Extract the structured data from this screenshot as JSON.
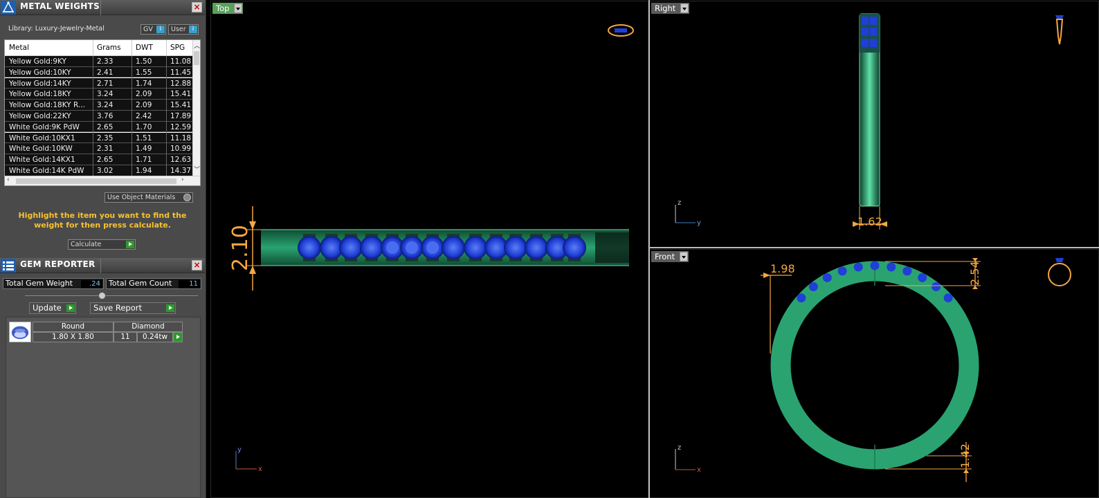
{
  "metal_panel": {
    "title": "METAL WEIGHTS",
    "library": "Library: Luxury-Jewelry-Metal",
    "unit_gv": "GV",
    "unit_user": "User",
    "columns": [
      "Metal",
      "Grams",
      "DWT",
      "SPG"
    ],
    "rows": [
      [
        "Yellow Gold:9KY",
        "2.33",
        "1.50",
        "11.08"
      ],
      [
        "Yellow Gold:10KY",
        "2.41",
        "1.55",
        "11.45"
      ],
      [
        "Yellow Gold:14KY",
        "2.71",
        "1.74",
        "12.88"
      ],
      [
        "Yellow Gold:18KY",
        "3.24",
        "2.09",
        "15.41"
      ],
      [
        "Yellow Gold:18KY R...",
        "3.24",
        "2.09",
        "15.41"
      ],
      [
        "Yellow Gold:22KY",
        "3.76",
        "2.42",
        "17.89"
      ],
      [
        "White Gold:9K PdW",
        "2.65",
        "1.70",
        "12.59"
      ],
      [
        "White Gold:10KX1",
        "2.35",
        "1.51",
        "11.18"
      ],
      [
        "White Gold:10KW",
        "2.31",
        "1.49",
        "10.99"
      ],
      [
        "White Gold:14KX1",
        "2.65",
        "1.71",
        "12.63"
      ],
      [
        "White Gold:14K PdW",
        "3.02",
        "1.94",
        "14.37"
      ]
    ],
    "use_object_materials": "Use Object Materials",
    "hint": "Highlight the item you want to find the weight for then press calculate.",
    "calculate": "Calculate"
  },
  "gem_panel": {
    "title": "GEM REPORTER",
    "total_weight_label": "Total Gem Weight",
    "total_weight_value": ".24",
    "total_count_label": "Total Gem Count",
    "total_count_value": "11",
    "update": "Update",
    "save_report": "Save Report",
    "gems": [
      {
        "shape": "Round",
        "material": "Diamond",
        "size": "1.80 X 1.80",
        "count": "11",
        "weight": "0.24tw"
      }
    ]
  },
  "viewports": {
    "top": {
      "label": "Top",
      "dimension": "2.10",
      "axis_a": "y",
      "axis_b": "x"
    },
    "right": {
      "label": "Right",
      "dimension": "1.62",
      "axis_a": "z",
      "axis_b": "y"
    },
    "front": {
      "label": "Front",
      "dim_left": "1.98",
      "dim_top": "2.54",
      "dim_bottom": "1.42",
      "axis_a": "z",
      "axis_b": "x"
    }
  },
  "colors": {
    "ring_green": "#2aa371",
    "gem_blue": "#1f3fd6",
    "dimension": "#f6a742",
    "hint": "#f6c231",
    "viewport_tab_green": "#59a05a"
  }
}
